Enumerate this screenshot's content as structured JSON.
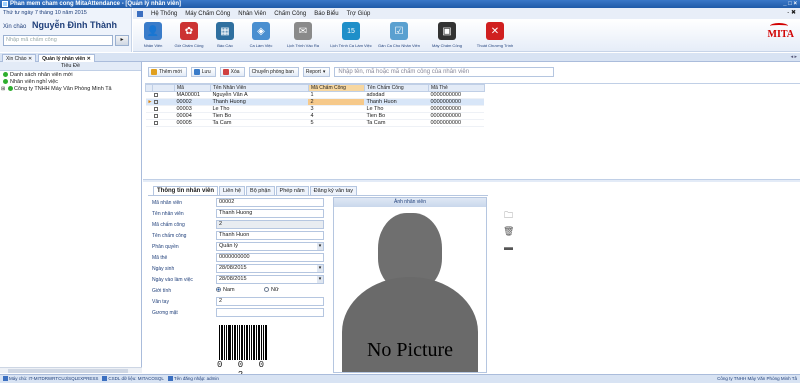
{
  "window": {
    "title": "Phan mem cham cong MitaAttendance - [Quản lý nhân viên]",
    "controls": "_ □ ×"
  },
  "topleft": {
    "date": "Thứ tư ngày 7 tháng 10 năm 2015",
    "greeting": "Xin chào",
    "user_name": "Nguyễn Đình Thành",
    "search_placeholder": "Nhập mã chấm công",
    "search_button": "Đi"
  },
  "menu": {
    "items": [
      "Hệ Thống",
      "Máy Chấm Công",
      "Nhân Viên",
      "Chấm Công",
      "Báo Biểu",
      "Trợ Giúp"
    ],
    "right": "- ✖"
  },
  "ribbon": {
    "buttons": [
      {
        "label": "Nhân Viên",
        "icon": "👤",
        "color": "#3a7cc9"
      },
      {
        "label": "Giờ Chấm Công",
        "icon": "✿",
        "color": "#cc3333"
      },
      {
        "label": "Báo Cáo",
        "icon": "▦",
        "color": "#2f6f9f"
      },
      {
        "label": "Ca Làm Việc",
        "icon": "◈",
        "color": "#4a8fd0"
      },
      {
        "label": "Lịch Trình Vào Ra",
        "icon": "✉",
        "color": "#8a8a8a"
      },
      {
        "label": "Lịch Trình Ca Làm Việc",
        "icon": "15",
        "color": "#1f8fc9"
      },
      {
        "label": "Gán Ca Cho Nhân Viên",
        "icon": "☑",
        "color": "#5aa0d0"
      },
      {
        "label": "Máy Chấm Công",
        "icon": "▣",
        "color": "#333333"
      },
      {
        "label": "Thoát Chương Trình",
        "icon": "✕",
        "color": "#d02020"
      }
    ],
    "logo": "MITA"
  },
  "tabs": [
    {
      "label": "Xin Chào",
      "active": false
    },
    {
      "label": "Quản lý nhân viên",
      "active": true
    }
  ],
  "tab_scroll": "◂ ▸",
  "left_panel": {
    "header": "Tiêu Đề",
    "items": [
      {
        "label": "Danh sách nhân viên mới"
      },
      {
        "label": "Nhân viên nghỉ việc"
      },
      {
        "label": "Công ty TNHH Máy Văn Phòng Minh Tâ"
      }
    ]
  },
  "toolbar": {
    "add": "Thêm mới",
    "save": "Lưu",
    "delete": "Xóa",
    "transfer": "Chuyển phòng ban",
    "report": "Report",
    "search_placeholder": "Nhập tên, mã hoặc mã chấm công của nhân viên"
  },
  "grid": {
    "columns": [
      "Mã",
      "Tên Nhân Viên",
      "Mã Chấm Công",
      "Tên Chấm Công",
      "Mã Thẻ"
    ],
    "rows": [
      {
        "ma": "MA00001",
        "ten": "Nguyễn Văn A",
        "mcc": "1",
        "tcc": "adsdad",
        "the": "0000000000",
        "selected": false
      },
      {
        "ma": "00002",
        "ten": "Thanh Huong",
        "mcc": "2",
        "tcc": "Thanh Huon",
        "the": "0000000000",
        "selected": true
      },
      {
        "ma": "00003",
        "ten": "Le Tho",
        "mcc": "3",
        "tcc": "Le Tho",
        "the": "0000000000",
        "selected": false
      },
      {
        "ma": "00004",
        "ten": "Tien Bo",
        "mcc": "4",
        "tcc": "Tien Bo",
        "the": "0000000000",
        "selected": false
      },
      {
        "ma": "00005",
        "ten": "Ta Cam",
        "mcc": "5",
        "tcc": "Ta Cam",
        "the": "0000000000",
        "selected": false
      }
    ]
  },
  "detail_tabs": [
    "Thông tin nhân viên",
    "Liên hệ",
    "Bộ phận",
    "Phép năm",
    "Đăng ký vân tay"
  ],
  "form": {
    "ma_nv_label": "Mã nhân viên",
    "ma_nv": "00002",
    "ten_nv_label": "Tên nhân viên",
    "ten_nv": "Thanh Huong",
    "ma_cc_label": "Mã chấm công",
    "ma_cc": "2",
    "ten_cc_label": "Tên chấm công",
    "ten_cc": "Thanh Huon",
    "phan_quyen_label": "Phân quyền",
    "phan_quyen": "Quản lý",
    "ma_the_label": "Mã thẻ",
    "ma_the": "0000000000",
    "ngay_sinh_label": "Ngày sinh",
    "ngay_sinh": "28/08/2015",
    "ngay_vao_label": "Ngày vào làm việc",
    "ngay_vao": "28/08/2015",
    "gioi_tinh_label": "Giới tính",
    "nam": "Nam",
    "nu": "Nữ",
    "van_tay_label": "Vân tay",
    "van_tay": "2",
    "guong_mat_label": "Gương mặt",
    "guong_mat": ""
  },
  "barcode": {
    "digits": "0 0 0 2"
  },
  "photo": {
    "header": "Ảnh nhân viên",
    "no_picture": "No Picture"
  },
  "status": {
    "server": "Máy chủ: IT-MITDRWRTCUJ\\SQLEXPRESS",
    "db": "CSDL dữ liệu: MITACOSQL",
    "user": "Tên đăng nhập: admin",
    "company": "Công ty TNHH Máy Văn Phòng Minh Tâ"
  }
}
